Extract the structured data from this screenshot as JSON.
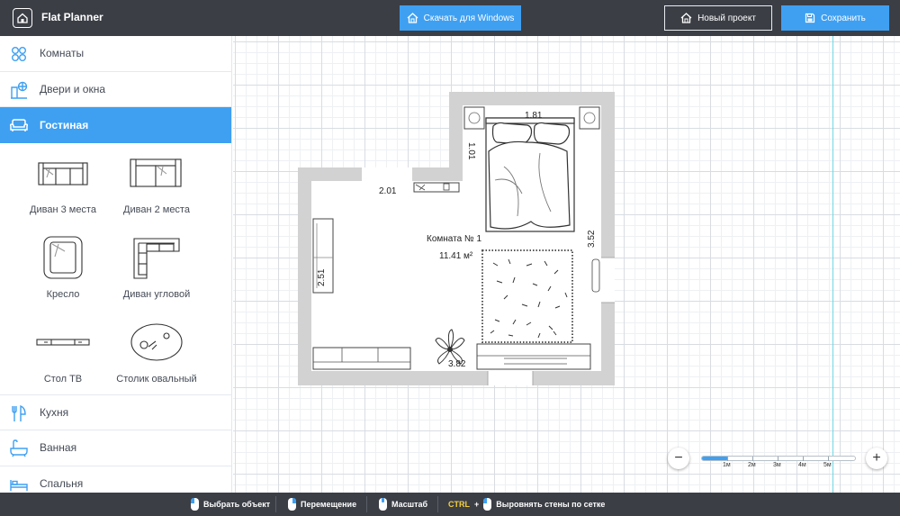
{
  "app": {
    "title": "Flat Planner"
  },
  "toolbar": {
    "download_label": "Скачать для Windows",
    "new_project_label": "Новый проект",
    "save_label": "Сохранить"
  },
  "sidebar": {
    "categories": [
      {
        "label": "Комнаты",
        "icon": "circles-icon"
      },
      {
        "label": "Двери и окна",
        "icon": "door-window-icon"
      },
      {
        "label": "Гостиная",
        "icon": "sofa-icon",
        "active": true
      },
      {
        "label": "Кухня",
        "icon": "cutlery-icon"
      },
      {
        "label": "Ванная",
        "icon": "bathtub-icon"
      },
      {
        "label": "Спальня",
        "icon": "bed-icon"
      }
    ],
    "items": [
      {
        "label": "Диван 3 места"
      },
      {
        "label": "Диван 2 места"
      },
      {
        "label": "Кресло"
      },
      {
        "label": "Диван угловой"
      },
      {
        "label": "Стол ТВ"
      },
      {
        "label": "Столик овальный"
      }
    ]
  },
  "plan": {
    "room_name": "Комната №  1",
    "room_area": "11.41 м²",
    "dimensions": [
      "1.81",
      "1.01",
      "2.01",
      "3.52",
      "2.51",
      "3.82"
    ]
  },
  "zoom": {
    "ticks": [
      "1м",
      "2м",
      "3м",
      "4м",
      "5м"
    ],
    "level_fraction": 0.17
  },
  "statusbar": {
    "select": "Выбрать объект",
    "move": "Перемещение",
    "scale": "Масштаб",
    "ctrl": "CTRL",
    "plus": "+",
    "align": "Выровнять стены по сетке"
  },
  "colors": {
    "accent": "#3fa0f2",
    "topbar": "#3b3e45",
    "wall": "#d4d4d4",
    "guide": "#6fd8e3"
  }
}
